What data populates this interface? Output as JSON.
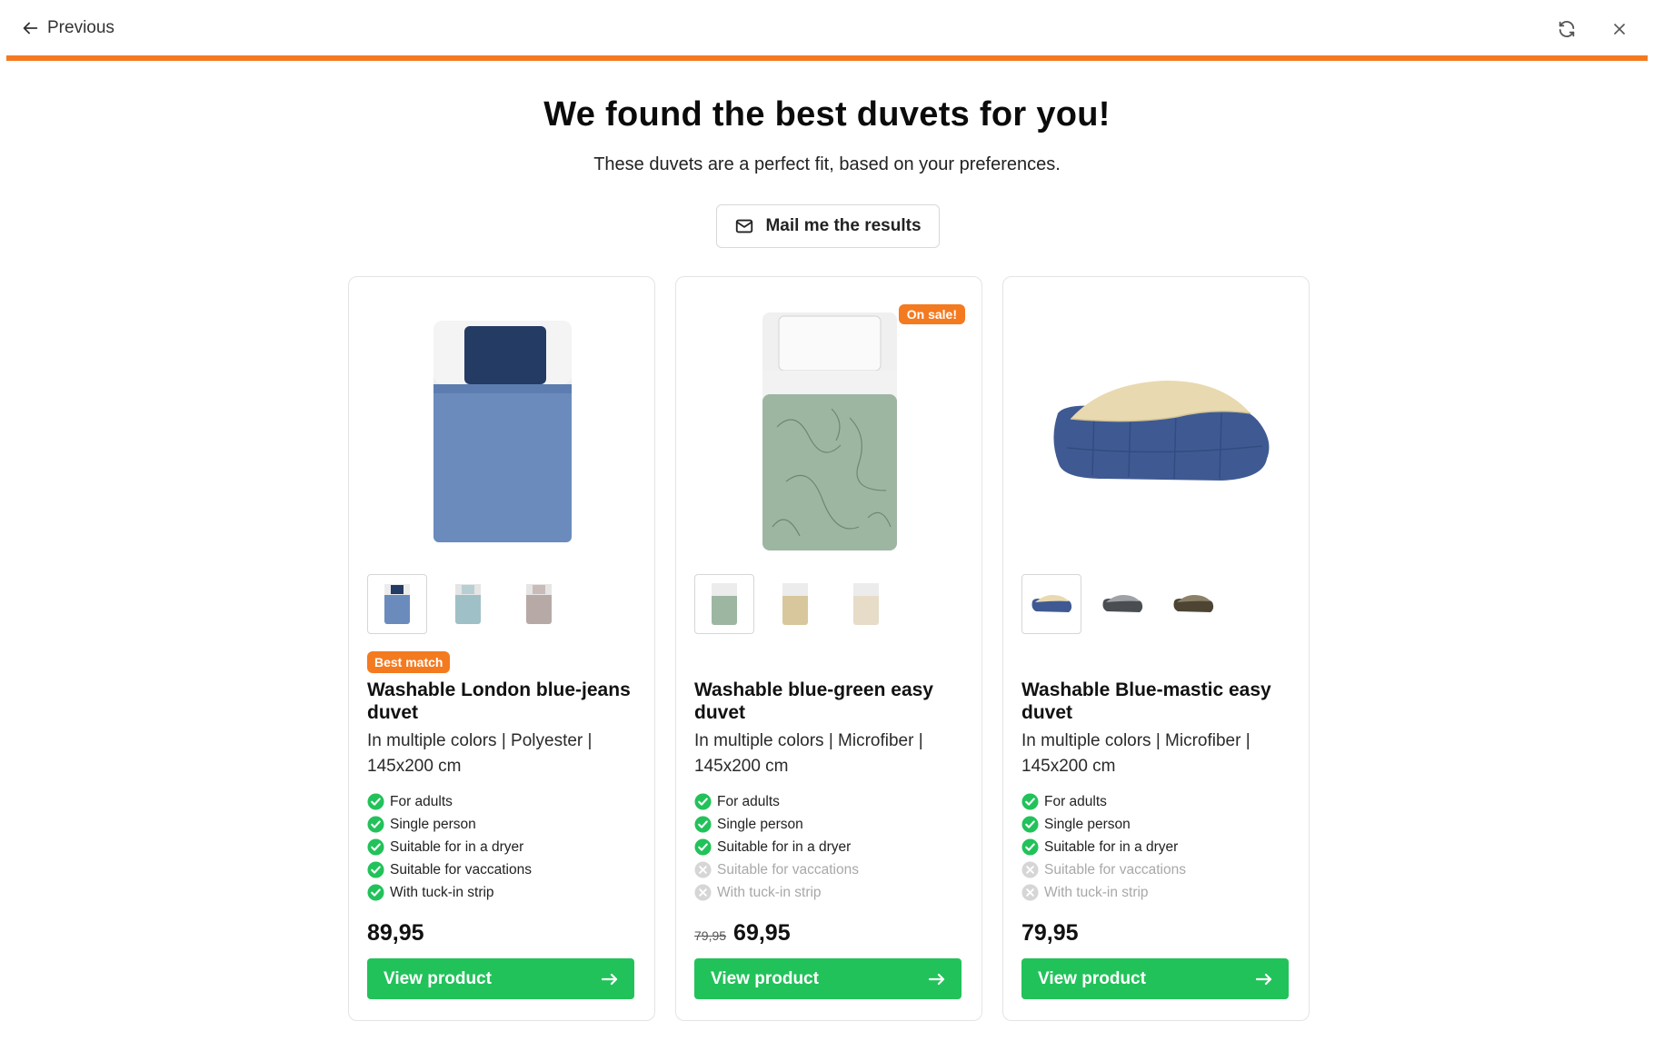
{
  "nav": {
    "previous_label": "Previous"
  },
  "progress": {
    "percent": 100,
    "color": "#f47a20"
  },
  "header": {
    "title": "We found the best duvets for you!",
    "subtitle": "These duvets are a perfect fit, based on your preferences.",
    "mail_button": "Mail me the results"
  },
  "products": [
    {
      "name": "Washable London blue-jeans duvet",
      "specs": "In multiple colors | Polyester | 145x200 cm",
      "badge": "Best match",
      "sale_badge": "",
      "features": [
        {
          "label": "For adults",
          "ok": true
        },
        {
          "label": "Single person",
          "ok": true
        },
        {
          "label": "Suitable for in a dryer",
          "ok": true
        },
        {
          "label": "Suitable for vaccations",
          "ok": true
        },
        {
          "label": "With tuck-in strip",
          "ok": true
        }
      ],
      "old_price": "",
      "price": "89,95",
      "button": "View product",
      "thumbnail_colors": [
        "blue",
        "light-blue",
        "taupe"
      ]
    },
    {
      "name": "Washable blue-green easy duvet",
      "specs": "In multiple colors | Microfiber | 145x200 cm",
      "badge": "",
      "sale_badge": "On sale!",
      "features": [
        {
          "label": "For adults",
          "ok": true
        },
        {
          "label": "Single person",
          "ok": true
        },
        {
          "label": "Suitable for in a dryer",
          "ok": true
        },
        {
          "label": "Suitable for vaccations",
          "ok": false
        },
        {
          "label": "With tuck-in strip",
          "ok": false
        }
      ],
      "old_price": "79,95",
      "price": "69,95",
      "button": "View product",
      "thumbnail_colors": [
        "sage-green",
        "beige",
        "cream"
      ]
    },
    {
      "name": "Washable Blue-mastic easy duvet",
      "specs": "In multiple colors | Microfiber | 145x200 cm",
      "badge": "",
      "sale_badge": "",
      "features": [
        {
          "label": "For adults",
          "ok": true
        },
        {
          "label": "Single person",
          "ok": true
        },
        {
          "label": "Suitable for in a dryer",
          "ok": true
        },
        {
          "label": "Suitable for vaccations",
          "ok": false
        },
        {
          "label": "With tuck-in strip",
          "ok": false
        }
      ],
      "old_price": "",
      "price": "79,95",
      "button": "View product",
      "thumbnail_colors": [
        "navy-cream",
        "grey",
        "olive-brown"
      ]
    }
  ],
  "colors": {
    "accent": "#f47a20",
    "cta": "#22c25a",
    "check": "#22c25a",
    "muted": "#c4c4c4"
  },
  "icons": {
    "back": "arrow-left-icon",
    "refresh": "refresh-icon",
    "close": "close-icon",
    "mail": "mail-icon",
    "check": "check-circle-icon",
    "cross": "x-circle-icon",
    "arrow": "arrow-right-icon"
  }
}
